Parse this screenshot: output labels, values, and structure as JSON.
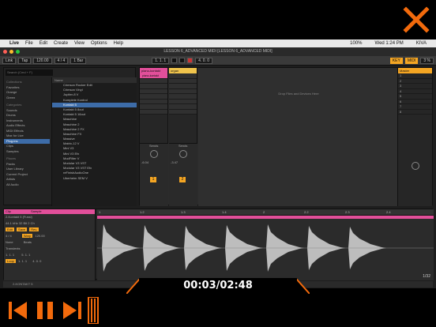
{
  "player": {
    "timecode": "00:03/02:48",
    "accent_color": "#f26a0c",
    "close_icon": "close-x-icon",
    "controls": [
      "skip-back-icon",
      "pause-icon",
      "skip-forward-icon"
    ]
  },
  "menubar": {
    "items": [
      "Live",
      "File",
      "Edit",
      "Create",
      "View",
      "Options",
      "Help"
    ],
    "status_right": [
      "100%",
      "Wed 1:24 PM",
      "KIVA"
    ]
  },
  "window": {
    "title": "LESSON 6_ADVANCED MIDI  [LESSON 6_ADVANCED MIDI]"
  },
  "transport": {
    "link": "Link",
    "tap": "Tap",
    "tempo": "120.00",
    "signature": "4 / 4",
    "loop": "1 Bar",
    "position": "1. 1. 1",
    "loop_len": "4. 0. 0",
    "key": "KEY",
    "midi": "MIDI",
    "cpu": "3 %"
  },
  "browser": {
    "search_placeholder": "Search (Cmd + F)",
    "collections_header": "Collections",
    "collections": [
      "Favorites",
      "Orange",
      "Green"
    ],
    "categories_header": "Categories",
    "categories": [
      "Sounds",
      "Drums",
      "Instruments",
      "Audio Effects",
      "MIDI Effects",
      "Max for Live",
      "Plug-ins",
      "Clips",
      "Samples"
    ],
    "selected_category": "Plug-ins",
    "places_header": "Places",
    "places": [
      "Packs",
      "User Library",
      "Current Project",
      "Artists",
      "All Audio"
    ],
    "files_header": "Name",
    "files": [
      "Crimson Rocker Edit",
      "Crimson Vinyl",
      "Jupiter-8 V",
      "Komplete Kontrol",
      "Kontakt 5",
      "Kontakt 5 8out",
      "Kontakt 5 16out",
      "Maschine",
      "Maschine 2",
      "Maschine 2 FX",
      "Maschine FX",
      "Massive",
      "Matrix-12 V",
      "Mini V3",
      "Mini V3 Efx",
      "ModFilter V",
      "Modular V3 VST",
      "Modular V3 VST Efx",
      "reFinishAudioOne",
      "Uberheim SEM V"
    ],
    "selected_file": "Kontakt 5"
  },
  "session": {
    "tracks": [
      {
        "name": "piano-kontakt",
        "color": "#e24f9a",
        "clip": "piano-kontakt",
        "number": "1",
        "volume": "-6.04"
      },
      {
        "name": "organ",
        "color": "#f0c44c",
        "clip": "",
        "number": "2",
        "volume": "-3.47"
      }
    ],
    "drop_message": "Drop Files and Devices Here",
    "master": {
      "name": "Master",
      "scenes": [
        "1",
        "2",
        "3",
        "4",
        "5",
        "6",
        "7",
        "8"
      ]
    },
    "sends_label": "Sends"
  },
  "detail": {
    "clip_title": "Clip",
    "sample_title": "Sample",
    "clip_name": "2-Kontakt 5 (Fussi)",
    "sample_info": "44.1 kHz 32 Bit 2 Ch",
    "buttons": [
      "Edit",
      "Save",
      "Rev."
    ],
    "signature": "4 / 4",
    "groove": "None",
    "warp": "Warp",
    "seg_bpm": "120.00",
    "mode": "Beats",
    "transients": "Transients",
    "start": "1. 1. 1",
    "end": "5. 1. 1",
    "loop": "Loop",
    "position": "1. 1. 1",
    "length": "4. 0. 0",
    "ruler": [
      "1",
      "1.2",
      "1.3",
      "1.4",
      "2",
      "2.2",
      "2.3",
      "2.4",
      "3",
      "3.2",
      "3.3",
      "3.4",
      "4",
      "4.2",
      "4.3",
      "4.4"
    ],
    "page": "1/32",
    "status": "2-KONTAKT 5"
  }
}
